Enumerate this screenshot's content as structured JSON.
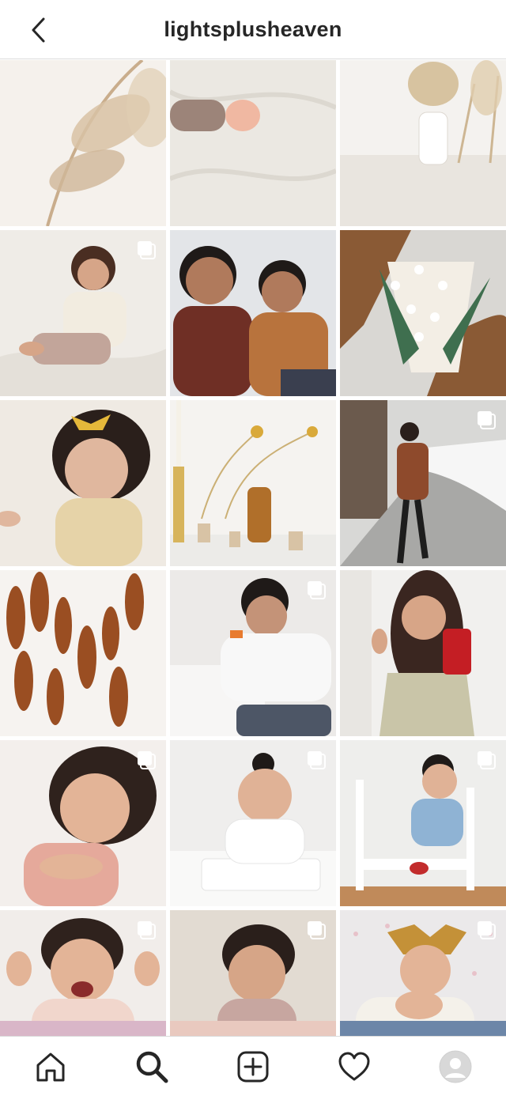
{
  "header": {
    "username": "lightsplusheaven",
    "back_icon": "chevron-left-icon"
  },
  "grid": {
    "rows": [
      [
        {
          "subject": "pampas grass",
          "bg": "#f5f1ec",
          "accent": "#c9ad8c",
          "multi": false
        },
        {
          "subject": "baby feet on white sheet",
          "bg": "#ebe8e2",
          "accent": "#9c8479",
          "multi": false
        },
        {
          "subject": "pampas in white vase",
          "bg": "#f4f2ef",
          "accent": "#cdb693",
          "multi": false
        }
      ],
      [
        {
          "subject": "toddler on white sheets",
          "bg": "#efece7",
          "accent": "#c2a59a",
          "multi": true
        },
        {
          "subject": "two brothers",
          "bg": "#e3e5e8",
          "accent": "#7b3a2c",
          "multi": false
        },
        {
          "subject": "open book with daisies",
          "bg": "#d9d7d3",
          "accent": "#8a5a35",
          "multi": false
        }
      ],
      [
        {
          "subject": "toddler with yellow bow",
          "bg": "#efeae3",
          "accent": "#e6d3a8",
          "multi": false
        },
        {
          "subject": "dried flowers and amber bottle",
          "bg": "#f5f3f0",
          "accent": "#b06f2a",
          "multi": false
        },
        {
          "subject": "boy in snowy street",
          "bg": "#d8d8d6",
          "accent": "#8e4a2c",
          "multi": true
        }
      ],
      [
        {
          "subject": "rust bunny tails",
          "bg": "#f6f3f0",
          "accent": "#9a4e22",
          "multi": false
        },
        {
          "subject": "boy in white sweater",
          "bg": "#eceae8",
          "accent": "#4d5666",
          "multi": true
        },
        {
          "subject": "woman mirror selfie",
          "bg": "#f1f0ee",
          "accent": "#c9c5a8",
          "multi": false
        }
      ],
      [
        {
          "subject": "smiling toddler pink top",
          "bg": "#f3efec",
          "accent": "#e5a99b",
          "multi": true
        },
        {
          "subject": "baby in high chair",
          "bg": "#efeeed",
          "accent": "#ffffff",
          "multi": true
        },
        {
          "subject": "baby on white rocking chair",
          "bg": "#eeeeec",
          "accent": "#8fb3d4",
          "multi": true
        }
      ],
      [
        {
          "subject": "laughing toddler drama queen",
          "bg": "#f1edea",
          "accent": "#f1d6cc",
          "multi": true
        },
        {
          "subject": "baby in mauve romper",
          "bg": "#e2dbd2",
          "accent": "#c7a6a0",
          "multi": true
        },
        {
          "subject": "baby with mustard bow",
          "bg": "#ebe9ea",
          "accent": "#c49138",
          "multi": true
        }
      ]
    ],
    "peek_colors": [
      "#d9b6c8",
      "#e9c9bf",
      "#6c86a8"
    ]
  },
  "nav": {
    "items": [
      {
        "name": "home-icon"
      },
      {
        "name": "search-icon"
      },
      {
        "name": "add-post-icon"
      },
      {
        "name": "heart-icon"
      },
      {
        "name": "profile-avatar"
      }
    ],
    "colors": {
      "icon": "#262626",
      "avatar_bg": "#d8d8d8"
    }
  }
}
